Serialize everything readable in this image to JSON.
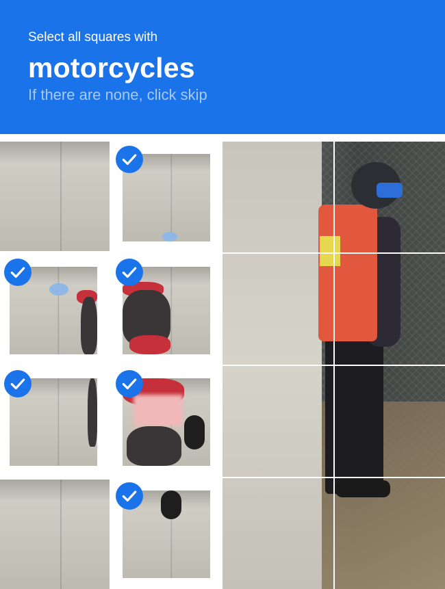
{
  "header": {
    "instruction": "Select all squares with",
    "target": "motorcycles",
    "hint": "If there are none, click skip"
  },
  "colors": {
    "header_bg": "#1a73e8",
    "check_bg": "#1a73e8",
    "hint_text": "#a9c9f5"
  },
  "left_grid": {
    "rows": 4,
    "cols": 2,
    "tiles": [
      {
        "id": "r1c1",
        "selected": false
      },
      {
        "id": "r1c2",
        "selected": true
      },
      {
        "id": "r2c1",
        "selected": true
      },
      {
        "id": "r2c2",
        "selected": true
      },
      {
        "id": "r3c1",
        "selected": true
      },
      {
        "id": "r3c2",
        "selected": true
      },
      {
        "id": "r4c1",
        "selected": false
      },
      {
        "id": "r4c2",
        "selected": true
      }
    ]
  },
  "right_grid": {
    "rows": 4,
    "cols": 2,
    "selected_count": 0
  },
  "icons": {
    "selected_marker": "checkmark-icon"
  }
}
